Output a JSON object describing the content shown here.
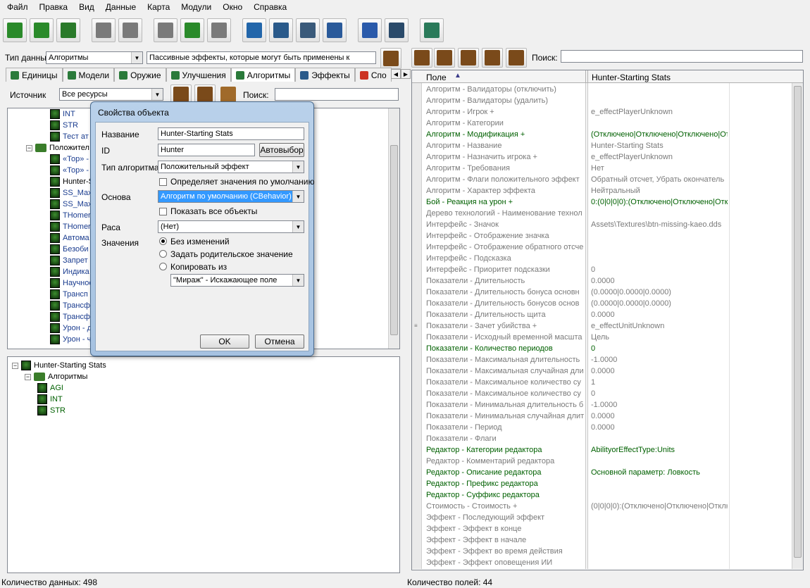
{
  "menu": [
    "Файл",
    "Правка",
    "Вид",
    "Данные",
    "Карта",
    "Модули",
    "Окно",
    "Справка"
  ],
  "toolbar": {
    "icons": [
      "new-document-icon",
      "open-folder-icon",
      "save-icon",
      "undo-icon",
      "redo-icon",
      "cut-icon",
      "copy-icon",
      "paste-icon",
      "terrain-editor-icon",
      "trigger-editor-icon",
      "data-editor-icon",
      "text-editor-icon",
      "import-icon",
      "ai-editor-icon",
      "cutscene-icon"
    ],
    "colors": [
      "#2a8a2a",
      "#2a8a2a",
      "#2a7a2a",
      "#7a7a7a",
      "#7a7a7a",
      "#7a7a7a",
      "#2a8a2a",
      "#7a7a7a",
      "#2266aa",
      "#2a5a8a",
      "#3a5a7a",
      "#2a5a9a",
      "#2a5aaa",
      "#2a4a6a",
      "#2a7a5a"
    ]
  },
  "data_type": {
    "label": "Тип данных:",
    "value": "Алгоритмы",
    "description": "Пассивные эффекты, которые могут быть применены к"
  },
  "tabs": [
    "Единицы",
    "Модели",
    "Оружие",
    "Улучшения",
    "Алгоритмы",
    "Эффекты",
    "Спо"
  ],
  "source": {
    "label": "Источник",
    "value": "Все ресурсы",
    "search_label": "Поиск:"
  },
  "right_search": {
    "label": "Поиск:"
  },
  "object_tree": [
    {
      "text": "INT",
      "kind": "leaf",
      "indent": 1,
      "blue": true
    },
    {
      "text": "STR",
      "kind": "leaf",
      "indent": 1,
      "blue": true
    },
    {
      "text": "Тест ат",
      "kind": "leaf",
      "indent": 1,
      "blue": true
    },
    {
      "text": "Положител",
      "kind": "folder",
      "indent": 0,
      "blue": false
    },
    {
      "text": "«Тор» -",
      "kind": "leaf",
      "indent": 1,
      "blue": true
    },
    {
      "text": "«Тор» -",
      "kind": "leaf",
      "indent": 1,
      "blue": true
    },
    {
      "text": "Hunter-S",
      "kind": "leaf",
      "indent": 1,
      "blue": false
    },
    {
      "text": "SS_Max",
      "kind": "leaf",
      "indent": 1,
      "blue": true
    },
    {
      "text": "SS_Max",
      "kind": "leaf",
      "indent": 1,
      "blue": true
    },
    {
      "text": "THomer",
      "kind": "leaf",
      "indent": 1,
      "blue": true
    },
    {
      "text": "THomer",
      "kind": "leaf",
      "indent": 1,
      "blue": true
    },
    {
      "text": "Автома",
      "kind": "leaf",
      "indent": 1,
      "blue": true
    },
    {
      "text": "Безоби",
      "kind": "leaf",
      "indent": 1,
      "blue": true
    },
    {
      "text": "Запрет",
      "kind": "leaf",
      "indent": 1,
      "blue": true
    },
    {
      "text": "Индика",
      "kind": "leaf",
      "indent": 1,
      "blue": true
    },
    {
      "text": "Научное",
      "kind": "leaf",
      "indent": 1,
      "blue": true
    },
    {
      "text": "Трансп",
      "kind": "leaf",
      "indent": 1,
      "blue": true
    },
    {
      "text": "Трансф",
      "kind": "leaf",
      "indent": 1,
      "blue": true
    },
    {
      "text": "Трансф",
      "kind": "leaf",
      "indent": 1,
      "blue": true
    },
    {
      "text": "Урон - д",
      "kind": "leaf",
      "indent": 1,
      "blue": true
    },
    {
      "text": "Урон - ч",
      "kind": "leaf",
      "indent": 1,
      "blue": true
    }
  ],
  "detail_tree": [
    {
      "text": "Hunter-Starting Stats",
      "kind": "root",
      "indent": 0
    },
    {
      "text": "Алгоритмы",
      "kind": "group",
      "indent": 1
    },
    {
      "text": "AGI",
      "kind": "leaf",
      "indent": 2
    },
    {
      "text": "INT",
      "kind": "leaf",
      "indent": 2
    },
    {
      "text": "STR",
      "kind": "leaf",
      "indent": 2
    }
  ],
  "grid": {
    "header_field": "Поле",
    "header_value": "Hunter-Starting Stats",
    "rows": [
      {
        "f": "Алгоритм - Валидаторы (отключить)",
        "v": "",
        "m": false
      },
      {
        "f": "Алгоритм - Валидаторы (удалить)",
        "v": "",
        "m": false
      },
      {
        "f": "Алгоритм - Игрок +",
        "v": "e_effectPlayerUnknown",
        "m": false
      },
      {
        "f": "Алгоритм - Категории",
        "v": "",
        "m": false
      },
      {
        "f": "Алгоритм - Модификация +",
        "v": "(Отключено|Отключено|Отключено|Отк",
        "m": true
      },
      {
        "f": "Алгоритм - Название",
        "v": "Hunter-Starting Stats",
        "m": false
      },
      {
        "f": "Алгоритм - Назначить игрока +",
        "v": "e_effectPlayerUnknown",
        "m": false
      },
      {
        "f": "Алгоритм - Требования",
        "v": "Нет",
        "m": false
      },
      {
        "f": "Алгоритм - Флаги положительного эффект",
        "v": "Обратный отсчет, Убрать окончатель",
        "m": false
      },
      {
        "f": "Алгоритм - Характер эффекта",
        "v": "Нейтральный",
        "m": false
      },
      {
        "f": "Бой - Реакция на урон +",
        "v": "0:(0|0|0|0):(Отключено|Отключено|Откл",
        "m": true
      },
      {
        "f": "Дерево технологий - Наименование технол",
        "v": "",
        "m": false
      },
      {
        "f": "Интерфейс - Значок",
        "v": "Assets\\Textures\\btn-missing-kaeo.dds",
        "m": false
      },
      {
        "f": "Интерфейс - Отображение значка",
        "v": "",
        "m": false
      },
      {
        "f": "Интерфейс - Отображение обратного отсче",
        "v": "",
        "m": false
      },
      {
        "f": "Интерфейс - Подсказка",
        "v": "",
        "m": false
      },
      {
        "f": "Интерфейс - Приоритет подсказки",
        "v": "0",
        "m": false
      },
      {
        "f": "Показатели - Длительность",
        "v": "0.0000",
        "m": false
      },
      {
        "f": "Показатели - Длительность бонуса основн",
        "v": "(0.0000|0.0000|0.0000)",
        "m": false
      },
      {
        "f": "Показатели - Длительность бонусов основ",
        "v": "(0.0000|0.0000|0.0000)",
        "m": false
      },
      {
        "f": "Показатели - Длительность щита",
        "v": "0.0000",
        "m": false
      },
      {
        "f": "Показатели - Зачет убийства +",
        "v": "e_effectUnitUnknown",
        "m": false
      },
      {
        "f": "Показатели - Исходный временной масшта",
        "v": "Цель",
        "m": false
      },
      {
        "f": "Показатели - Количество периодов",
        "v": "0",
        "m": true
      },
      {
        "f": "Показатели - Максимальная длительность",
        "v": "-1.0000",
        "m": false
      },
      {
        "f": "Показатели - Максимальная случайная дли",
        "v": "0.0000",
        "m": false
      },
      {
        "f": "Показатели - Максимальное количество су",
        "v": "1",
        "m": false
      },
      {
        "f": "Показатели - Максимальное количество су",
        "v": "0",
        "m": false
      },
      {
        "f": "Показатели - Минимальная длительность б",
        "v": "-1.0000",
        "m": false
      },
      {
        "f": "Показатели - Минимальная случайная длит",
        "v": "0.0000",
        "m": false
      },
      {
        "f": "Показатели - Период",
        "v": "0.0000",
        "m": false
      },
      {
        "f": "Показатели - Флаги",
        "v": "",
        "m": false
      },
      {
        "f": "Редактор - Категории редактора",
        "v": "AbilityorEffectType:Units",
        "m": true
      },
      {
        "f": "Редактор - Комментарий редактора",
        "v": "",
        "m": false
      },
      {
        "f": "Редактор - Описание редактора",
        "v": "Основной параметр: Ловкость",
        "m": true
      },
      {
        "f": "Редактор - Префикс редактора",
        "v": "",
        "m": true
      },
      {
        "f": "Редактор - Суффикс редактора",
        "v": "",
        "m": true
      },
      {
        "f": "Стоимость - Стоимость +",
        "v": "(0|0|0|0):(Отключено|Отключено|Отключ",
        "m": false
      },
      {
        "f": "Эффект - Последующий эффект",
        "v": "",
        "m": false
      },
      {
        "f": "Эффект - Эффект в конце",
        "v": "",
        "m": false
      },
      {
        "f": "Эффект - Эффект в начале",
        "v": "",
        "m": false
      },
      {
        "f": "Эффект - Эффект во время действия",
        "v": "",
        "m": false
      },
      {
        "f": "Эффект - Эффект оповещения ИИ",
        "v": "",
        "m": false
      }
    ]
  },
  "dialog": {
    "title": "Свойства объекта",
    "name_label": "Название",
    "name_value": "Hunter-Starting Stats",
    "id_label": "ID",
    "id_value": "Hunter",
    "autoselect": "Автовыбор",
    "type_label": "Тип алгоритма",
    "type_value": "Положительный эффект",
    "defaults_check": "Определяет значения по умолчанию",
    "base_label": "Основа",
    "base_value": "Алгоритм по умолчанию (CBehavior)",
    "show_all": "Показать все объекты",
    "race_label": "Раса",
    "race_value": "(Нет)",
    "values_label": "Значения",
    "radio_none": "Без изменений",
    "radio_parent": "Задать родительское значение",
    "radio_copy": "Копировать из",
    "copy_value": "\"Мираж\" - Искажающее поле",
    "ok": "OK",
    "cancel": "Отмена"
  },
  "status_left": "Количество данных: 498",
  "status_right": "Количество полей: 44"
}
